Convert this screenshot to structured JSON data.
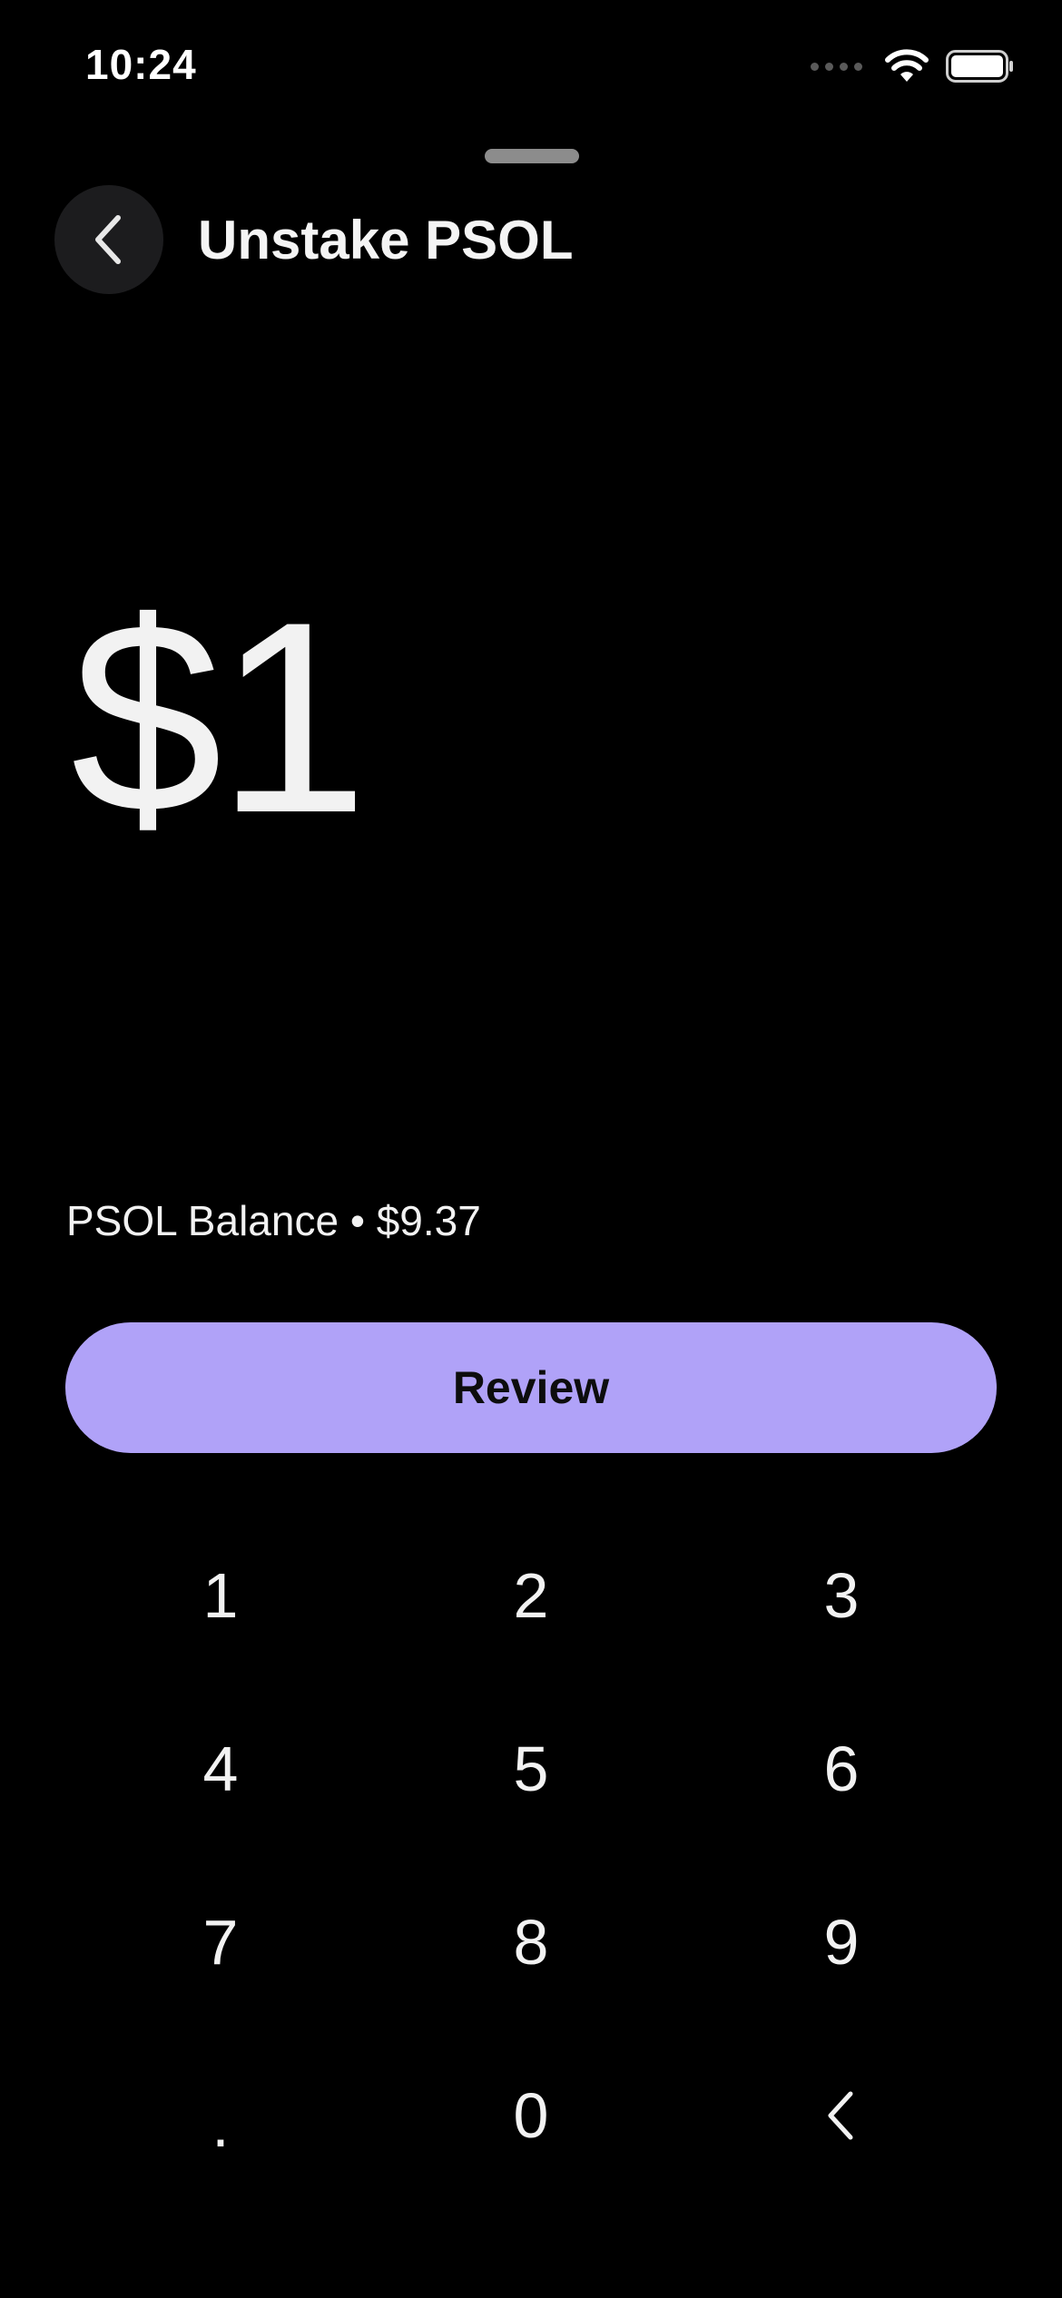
{
  "status_bar": {
    "time": "10:24"
  },
  "header": {
    "title": "Unstake PSOL"
  },
  "amount": {
    "display": "$1"
  },
  "balance": {
    "text": "PSOL Balance • $9.37"
  },
  "actions": {
    "review_label": "Review"
  },
  "keypad": {
    "keys": [
      "1",
      "2",
      "3",
      "4",
      "5",
      "6",
      "7",
      "8",
      "9",
      ".",
      "0"
    ]
  },
  "colors": {
    "background": "#000000",
    "accent": "#b0a2f8",
    "back_button_bg": "#1c1c1e"
  },
  "icons": {
    "back": "chevron-left-icon",
    "backspace": "chevron-left-icon",
    "wifi": "wifi-icon",
    "battery": "battery-icon"
  }
}
